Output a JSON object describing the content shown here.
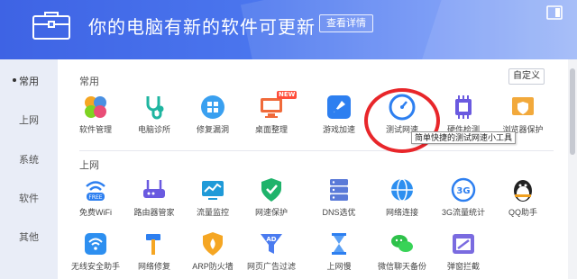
{
  "header": {
    "title": "你的电脑有新的软件可更新",
    "details_button": "查看详情",
    "icon": "toolbox-icon",
    "corner_icon": "window-restore-icon"
  },
  "sidebar": {
    "items": [
      {
        "label": "常用",
        "active": true
      },
      {
        "label": "上网",
        "active": false
      },
      {
        "label": "系统",
        "active": false
      },
      {
        "label": "软件",
        "active": false
      },
      {
        "label": "其他",
        "active": false
      }
    ]
  },
  "content": {
    "custom_button": "自定义",
    "sections": [
      {
        "title": "常用",
        "tools": [
          {
            "label": "软件管理",
            "icon": "software-manager-icon"
          },
          {
            "label": "电脑诊所",
            "icon": "stethoscope-icon"
          },
          {
            "label": "修复漏洞",
            "icon": "windows-repair-icon"
          },
          {
            "label": "桌面整理",
            "icon": "desktop-organizer-icon",
            "badge": "NEW"
          },
          {
            "label": "游戏加速",
            "icon": "rocket-icon"
          },
          {
            "label": "测试网速",
            "icon": "speedometer-icon"
          },
          {
            "label": "硬件检测",
            "icon": "chip-icon"
          },
          {
            "label": "浏览器保护",
            "icon": "browser-shield-icon"
          }
        ]
      },
      {
        "title": "上网",
        "tools": [
          {
            "label": "免费WiFi",
            "icon": "wifi-free-icon"
          },
          {
            "label": "路由器管家",
            "icon": "router-icon"
          },
          {
            "label": "流量监控",
            "icon": "traffic-monitor-icon"
          },
          {
            "label": "网速保护",
            "icon": "network-shield-icon"
          },
          {
            "label": "DNS选优",
            "icon": "dns-server-icon"
          },
          {
            "label": "网络连接",
            "icon": "globe-icon"
          },
          {
            "label": "3G流量统计",
            "icon": "3g-stats-icon"
          },
          {
            "label": "QQ助手",
            "icon": "qq-penguin-icon"
          }
        ]
      },
      {
        "title": "",
        "tools": [
          {
            "label": "无线安全助手",
            "icon": "wifi-shield-icon"
          },
          {
            "label": "网络修复",
            "icon": "hammer-icon"
          },
          {
            "label": "ARP防火墙",
            "icon": "firewall-icon"
          },
          {
            "label": "网页广告过滤",
            "icon": "ad-filter-icon"
          },
          {
            "label": "上网慢",
            "icon": "hourglass-icon"
          },
          {
            "label": "微信聊天备份",
            "icon": "wechat-icon"
          },
          {
            "label": "弹窗拦截",
            "icon": "popup-block-icon"
          }
        ]
      }
    ]
  },
  "tooltip": {
    "text": "简单快捷的测试网速小工具"
  },
  "highlight": {
    "target": "测试网速",
    "color": "#e8262a"
  },
  "colors": {
    "header_start": "#3e63e4",
    "header_end": "#93b0f8",
    "accent": "#4a7bf0"
  }
}
